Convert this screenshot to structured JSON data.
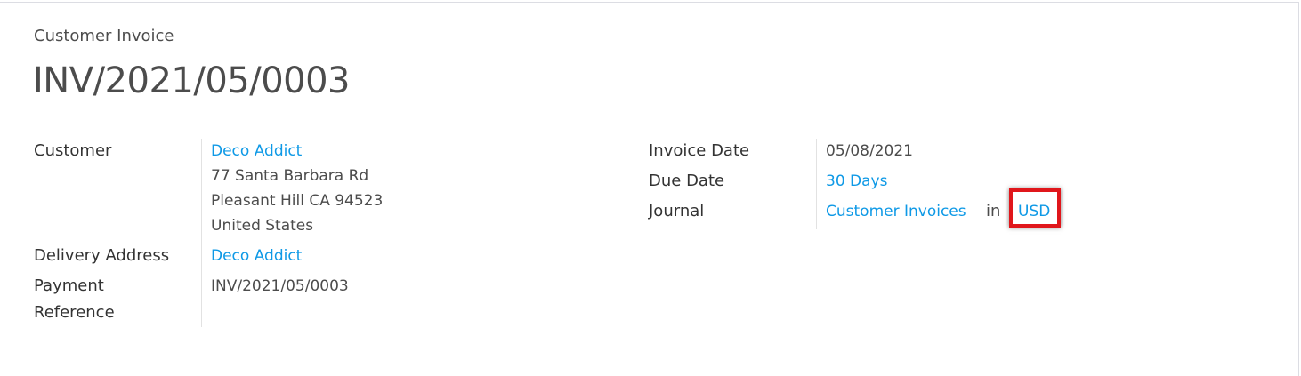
{
  "header": {
    "subtitle": "Customer Invoice",
    "title": "INV/2021/05/0003"
  },
  "left": {
    "customer_label": "Customer",
    "customer_name": "Deco Addict",
    "address": [
      "77 Santa Barbara Rd",
      "Pleasant Hill CA 94523",
      "United States"
    ],
    "delivery_label": "Delivery Address",
    "delivery_value": "Deco Addict",
    "payment_label_1": "Payment",
    "payment_label_2": "Reference",
    "payment_value": "INV/2021/05/0003"
  },
  "right": {
    "invoice_date_label": "Invoice Date",
    "invoice_date": "05/08/2021",
    "due_date_label": "Due Date",
    "due_date": "30 Days",
    "journal_label": "Journal",
    "journal": "Customer Invoices",
    "in": "in",
    "currency": "USD"
  },
  "colors": {
    "link": "#0e99e6",
    "highlight": "#e0161b"
  }
}
